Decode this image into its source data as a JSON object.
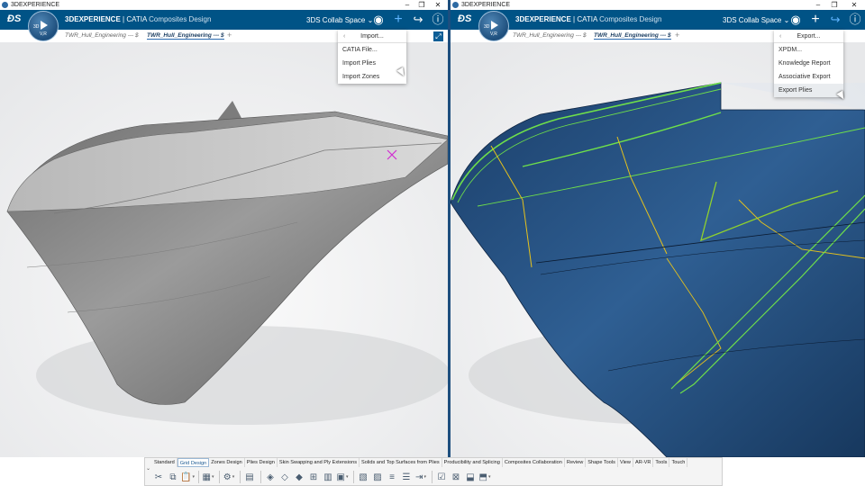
{
  "left_window": {
    "title": "3DEXPERIENCE",
    "brand_bold": "3DEXPERIENCE",
    "brand_app": "| CATIA",
    "brand_sub": "Composites Design",
    "compass_label": "V,R",
    "compass_3d": "3D",
    "collab_space": "3DS Collab Space",
    "tabs": [
      {
        "label": "TWR_Hull_Engineering --- $"
      },
      {
        "label": "TWR_Hull_Engineering --- $"
      }
    ],
    "menu": {
      "header": "Import...",
      "items": [
        "CATIA File...",
        "Import Plies",
        "Import Zones"
      ]
    }
  },
  "right_window": {
    "title": "3DEXPERIENCE",
    "brand_bold": "3DEXPERIENCE",
    "brand_app": "| CATIA",
    "brand_sub": "Composites Design",
    "compass_label": "V,R",
    "compass_3d": "3D",
    "collab_space": "3DS Collab Space",
    "tabs": [
      {
        "label": "TWR_Hull_Engineering --- $"
      },
      {
        "label": "TWR_Hull_Engineering --- $"
      }
    ],
    "menu": {
      "header": "Export...",
      "items": [
        "XPDM...",
        "Knowledge Report",
        "Associative Export",
        "Export Plies"
      ]
    }
  },
  "action_bar": {
    "tabs": [
      "Standard",
      "Grid Design",
      "Zones Design",
      "Plies Design",
      "Skin Swapping and Ply Extensions",
      "Solids and Top Surfaces from Plies",
      "Producibility and Splicing",
      "Composites Collaboration",
      "Review",
      "Shape Tools",
      "View",
      "AR-VR",
      "Tools",
      "Touch"
    ],
    "active_tab": "Grid Design"
  },
  "icons": {
    "window_minimize": "minimize-icon",
    "window_restore": "restore-icon",
    "window_close": "close-icon",
    "user": "user-icon",
    "add": "plus-icon",
    "share": "share-icon",
    "help": "help-icon"
  },
  "colors": {
    "topbar": "#005386",
    "accent": "#5fb4ff",
    "hull_left": "#8a8a8a",
    "hull_right": "#234a78",
    "ply_green": "#6fe04a",
    "ply_yellow": "#e6c21c"
  }
}
